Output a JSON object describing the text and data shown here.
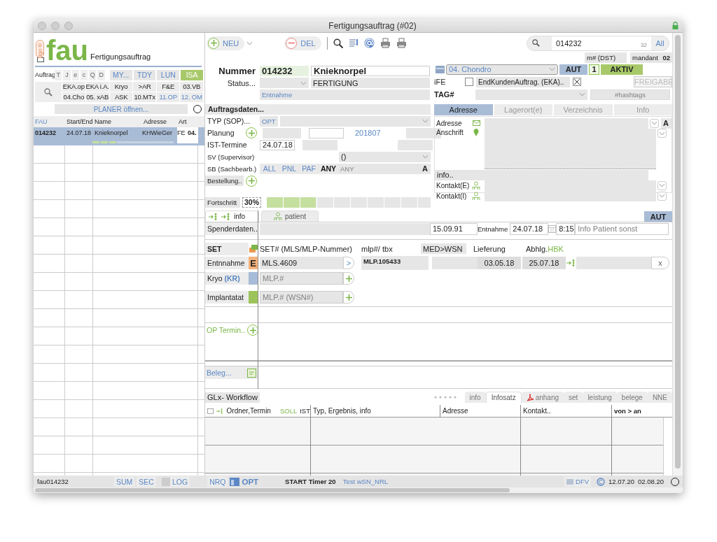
{
  "window": {
    "title": "Fertigungsauftrag (#02)"
  },
  "app": {
    "badge": "igo®",
    "name": "fau",
    "subtitle": "Fertigungsauftrag"
  },
  "toolbar": {
    "new_button": "NEU",
    "delete_button": "DEL"
  },
  "search": {
    "value": "014232",
    "count": "32",
    "scope_button": "All"
  },
  "left_panel": {
    "filter_label": "Auftrag",
    "letter_filters": [
      "T",
      "J",
      "e",
      "c",
      "Q",
      "D"
    ],
    "views": [
      {
        "label": "MY...",
        "selected": false
      },
      {
        "label": "TDY",
        "selected": false
      },
      {
        "label": "LUN",
        "selected": false
      },
      {
        "label": "ISA",
        "selected": true
      }
    ],
    "quick_filters": [
      {
        "label": "EKA.op",
        "kind": "plain"
      },
      {
        "label": "EKA i.A.",
        "kind": "plain"
      },
      {
        "label": "Kryo",
        "kind": "plain"
      },
      {
        "label": ">AR",
        "kind": "plain"
      },
      {
        "label": "F&E",
        "kind": "plain"
      },
      {
        "label": "03.VB",
        "kind": "plain"
      },
      {
        "label": "04.Cho",
        "kind": "plain"
      },
      {
        "label": "05. xAB",
        "kind": "plain"
      },
      {
        "label": "ASK",
        "kind": "plain"
      },
      {
        "label": "10.MTx",
        "kind": "plain"
      },
      {
        "label": "11.OP",
        "kind": "link"
      },
      {
        "label": "12. OM",
        "kind": "link"
      }
    ],
    "planner_button": "PLANER öffnen...",
    "table": {
      "columns": [
        "FAU",
        "Start/End",
        "Name",
        "Adresse",
        "Art"
      ],
      "rows": [
        {
          "fau": "014232",
          "start_end": "24.07.18",
          "name": "Knieknorpel",
          "adresse": "KHWieGer",
          "art": "FE",
          "column_6": "04.",
          "selected": true,
          "level": 0.3
        }
      ]
    }
  },
  "header": {
    "m_dst": "m# (DST)",
    "mandant_label": "mandant",
    "mandant": "02",
    "nummer_label": "Nummer",
    "nummer": "014232",
    "name": "Knieknorpel",
    "status_label": "Status...",
    "status": "FERTIGUNG",
    "status_sub": "Entnahme",
    "category": "04. Chondro",
    "aut_button": "AUT",
    "level_badge": "1",
    "state_badge": "AKTIV",
    "ife_label": "iFE",
    "ife_checked": false,
    "eka_label": "EndKundenAuftrag. (EKA)..",
    "eka_checked": true,
    "release_button": "FREIGABE",
    "release_disabled": true,
    "tag_label": "TAG#",
    "hashtags_placeholder": "#hashtags"
  },
  "order_data": {
    "title": "Auftragsdaten...",
    "typ_label": "TYP (SOP)...",
    "typ_button": "OPT",
    "planung_label": "Planung",
    "planung_period": "201807",
    "ist_label": "IST-Termine",
    "ist_date": "24.07.18",
    "sv_label": "SV (Supervisor)",
    "sv_value": "()",
    "sb_label": "SB (Sachbearb.)",
    "sb_filters": [
      {
        "label": "ALL",
        "selected": false
      },
      {
        "label": "PNL",
        "selected": false
      },
      {
        "label": "PAF",
        "selected": false
      },
      {
        "label": "ANY",
        "selected": true
      }
    ],
    "sb_placeholder": "ANY",
    "sb_button": "A",
    "bestellung_label": "Bestellung..",
    "progress_label": "Fortschritt",
    "progress_reading": "30%",
    "progress": {
      "level": 0.3
    }
  },
  "address_tabs": [
    {
      "label": "Adresse",
      "selected": true
    },
    {
      "label": "Lagerort(e)",
      "selected": false
    },
    {
      "label": "Verzeichnis",
      "selected": false
    },
    {
      "label": "Info",
      "selected": false
    }
  ],
  "address": {
    "adresse_label": "Adresse",
    "anschrift_label": "Anschrift",
    "info_label": "info..",
    "kontakt_e_label": "Kontakt(E)",
    "kontakt_i_label": "Kontakt(I)",
    "a_button": "A"
  },
  "detail_tabs": [
    {
      "label": "info",
      "selected": true
    },
    {
      "label": "patient",
      "selected": false
    }
  ],
  "aut_button": "AUT",
  "donor": {
    "label": "Spenderdaten..",
    "birth_date": "15.09.91",
    "entnahme_label": "Entnahme",
    "entnahme_date": "24.07.18",
    "time": "8:15",
    "info_placeholder": "Info Patient sonst"
  },
  "set": {
    "label": "SET",
    "columns": [
      "SET# (MLS/MLP-Nummer)",
      "mlp#/ tbx",
      "MED>WSN",
      "Lieferung"
    ],
    "abhlg_label": "Abhlg.",
    "abhlg_code": "HBK",
    "rows": [
      {
        "kind": "entry",
        "label": "Entnnahme",
        "badge": "E",
        "color": "#f4b27c",
        "value": "MLS.4609",
        "button": ">",
        "mlp": "MLP.105433",
        "lieferung": "03.05.18",
        "abhlg": "25.07.18",
        "remove_button": "x"
      },
      {
        "kind": "add",
        "label": "Kryo",
        "code": "(KR)",
        "color": "#a7bcd8",
        "placeholder": "MLP.#"
      },
      {
        "kind": "add",
        "label": "Implantatat",
        "color": "#9dc45b",
        "placeholder": "MLP.# (WSN#)"
      }
    ]
  },
  "op_termin_label": "OP Termin..",
  "beleg_label": "Beleg...",
  "workflow": {
    "title": "GLx- Workflow",
    "tabs": [
      {
        "label": "info",
        "kind": "plain",
        "selected": false
      },
      {
        "label": "Infosatz",
        "kind": "plain",
        "selected": true
      },
      {
        "label": "anhang",
        "kind": "pdf",
        "selected": false
      },
      {
        "label": "set",
        "kind": "plain",
        "selected": false
      },
      {
        "label": "leistung",
        "kind": "plain",
        "selected": false
      },
      {
        "label": "belege",
        "kind": "plain",
        "selected": false
      },
      {
        "label": "NNE",
        "kind": "plain",
        "selected": false
      }
    ],
    "columns": {
      "ordner": "Ordner,Termin",
      "soll": "SOLL",
      "ist": "IST",
      "typ": "Typ, Ergebnis,  info",
      "adresse": "Adresse",
      "kontakt": "Kontakt..",
      "von_an": "von > an"
    }
  },
  "status_bar": {
    "record": "fau014232",
    "buttons": [
      {
        "label": "SUM",
        "kind": "plain"
      },
      {
        "label": "SEC",
        "kind": "plain"
      },
      {
        "label": "LOG",
        "kind": "check",
        "checked": false
      },
      {
        "label": "NRQ",
        "kind": "plain"
      },
      {
        "label": "OPT",
        "kind": "icon"
      }
    ],
    "timer": "START Timer 20",
    "test": "Test wSN_NRL",
    "dfv": "DFV",
    "date_from": "12.07.20",
    "date_to": "02.08.20"
  }
}
